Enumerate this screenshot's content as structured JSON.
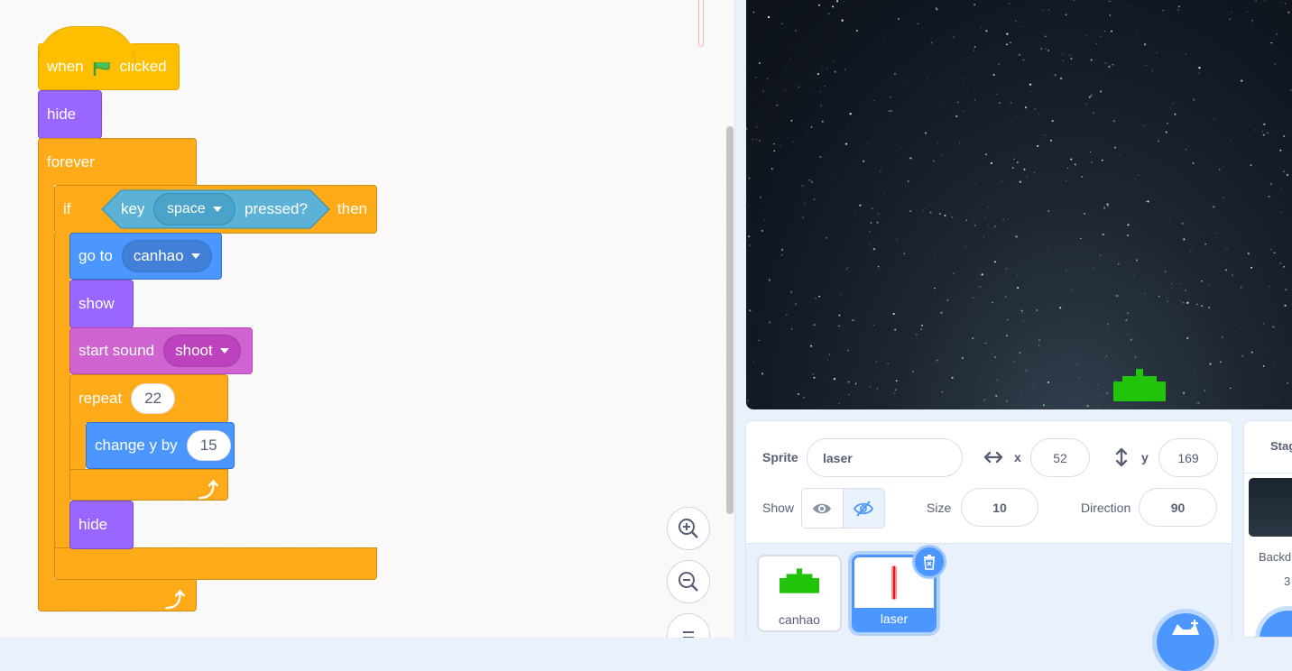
{
  "script": {
    "when_label": "when",
    "clicked_label": "clicked",
    "hide1": "hide",
    "forever": "forever",
    "if": "if",
    "key": "key",
    "key_value": "space",
    "pressed": "pressed?",
    "then": "then",
    "goto": "go to",
    "goto_value": "canhao",
    "show": "show",
    "start_sound": "start sound",
    "sound_value": "shoot",
    "repeat": "repeat",
    "repeat_value": "22",
    "change_y": "change y by",
    "change_y_value": "15",
    "hide2": "hide"
  },
  "sprite_info": {
    "sprite_label": "Sprite",
    "sprite_name": "laser",
    "x_label": "x",
    "x_value": "52",
    "y_label": "y",
    "y_value": "169",
    "show_label": "Show",
    "size_label": "Size",
    "size_value": "10",
    "direction_label": "Direction",
    "direction_value": "90"
  },
  "sprites": [
    {
      "name": "canhao",
      "selected": false
    },
    {
      "name": "laser",
      "selected": true
    }
  ],
  "stage_panel": {
    "title": "Stag",
    "backdrops_label": "Backd",
    "backdrops_count": "3"
  },
  "colors": {
    "events": "#ffbf00",
    "control": "#ffab19",
    "looks": "#9966ff",
    "motion": "#4c97ff",
    "sound": "#cf63cf",
    "sensing": "#5cb1d6",
    "accent": "#4c97ff"
  }
}
